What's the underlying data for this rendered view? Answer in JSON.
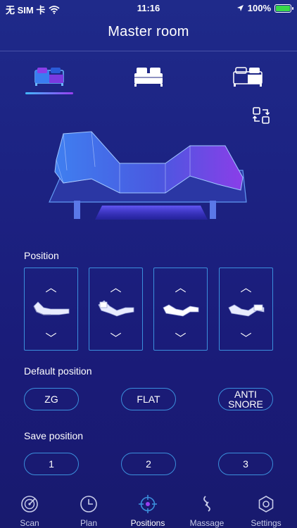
{
  "status_bar": {
    "carrier": "无 SIM 卡",
    "time": "11:16",
    "battery": "100%",
    "battery_level": 1.0
  },
  "header": {
    "title": "Master room"
  },
  "bed_tabs": [
    {
      "icon": "left-side-bed-icon",
      "active": true
    },
    {
      "icon": "full-bed-icon",
      "active": false
    },
    {
      "icon": "right-side-bed-icon",
      "active": false
    }
  ],
  "sections": {
    "position": "Position",
    "default_position": "Default position",
    "save_position": "Save position"
  },
  "position_controls": {
    "up_glyph": "︿",
    "down_glyph": "﹀"
  },
  "default_positions": [
    "ZG",
    "FLAT",
    "ANTI SNORE"
  ],
  "save_positions": [
    "1",
    "2",
    "3"
  ],
  "nav": {
    "items": [
      {
        "label": "Scan",
        "icon": "radar-icon"
      },
      {
        "label": "Plan",
        "icon": "clock-icon"
      },
      {
        "label": "Positions",
        "icon": "crosshair-icon",
        "active": true
      },
      {
        "label": "Massage",
        "icon": "wave-icon"
      },
      {
        "label": "Settings",
        "icon": "gear-icon"
      }
    ]
  },
  "colors": {
    "accent_blue": "#3b8fdc",
    "accent_purple": "#9a3ef0",
    "battery_green": "#38d94a"
  }
}
